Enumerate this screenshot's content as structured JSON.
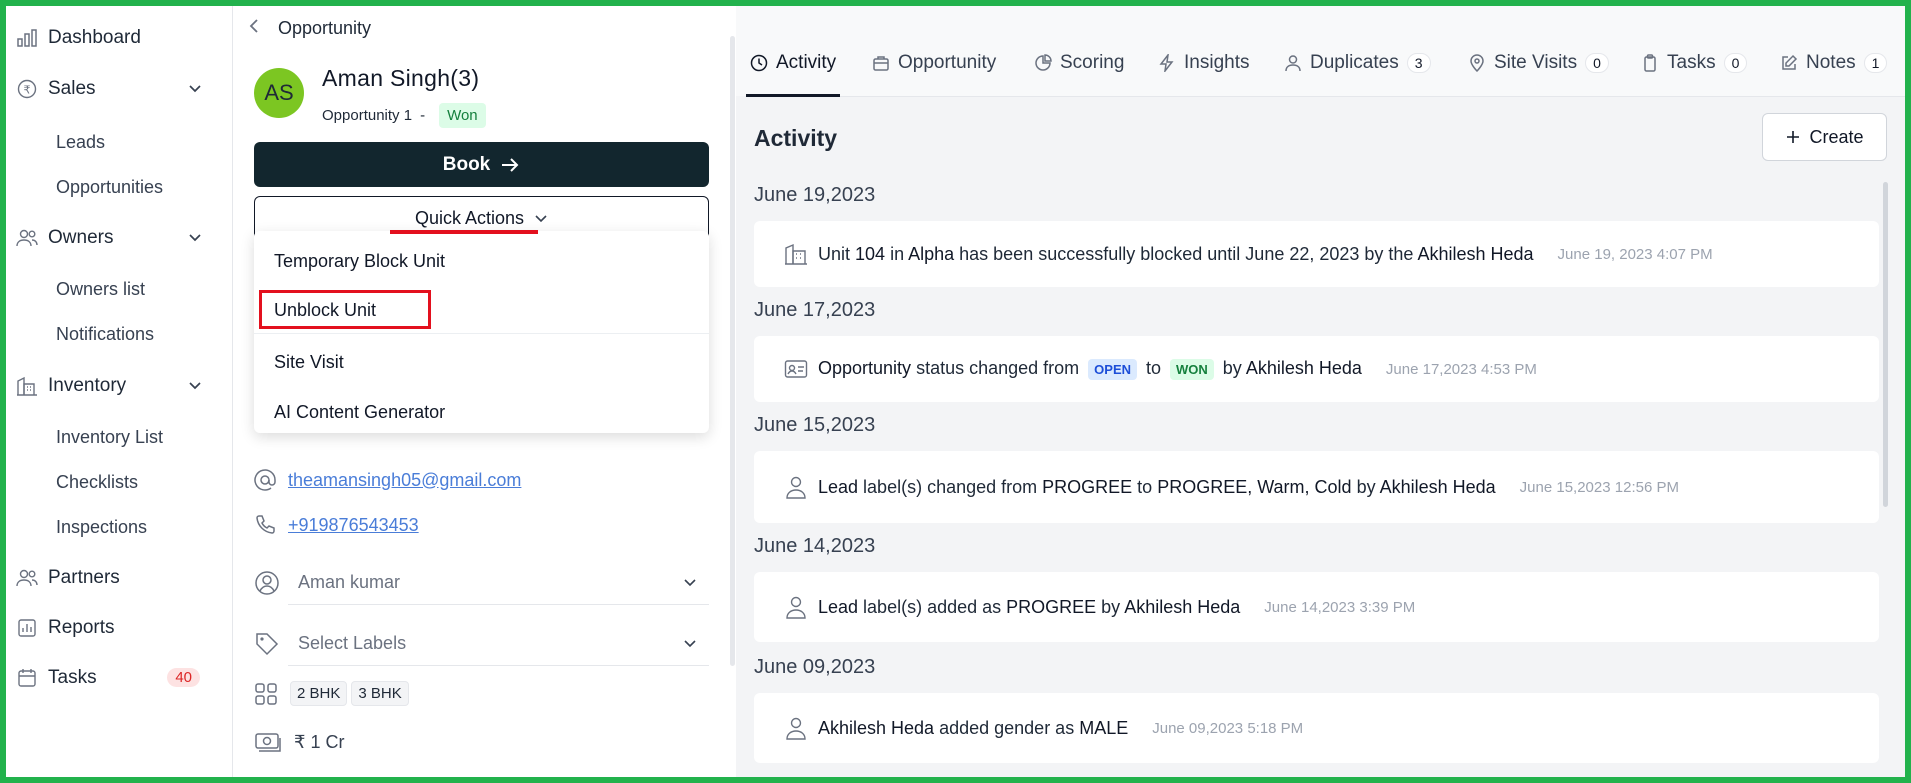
{
  "sidebar": {
    "items": [
      {
        "label": "Dashboard"
      },
      {
        "label": "Sales"
      },
      {
        "label": "Leads"
      },
      {
        "label": "Opportunities"
      },
      {
        "label": "Owners"
      },
      {
        "label": "Owners list"
      },
      {
        "label": "Notifications"
      },
      {
        "label": "Inventory"
      },
      {
        "label": "Inventory List"
      },
      {
        "label": "Checklists"
      },
      {
        "label": "Inspections"
      },
      {
        "label": "Partners"
      },
      {
        "label": "Reports"
      },
      {
        "label": "Tasks",
        "badge": "40"
      }
    ]
  },
  "detail": {
    "breadcrumb": "Opportunity",
    "avatar_initials": "AS",
    "name": "Aman  Singh(3)",
    "opportunity_label": "Opportunity 1",
    "separator": "-",
    "status": "Won",
    "book_label": "Book",
    "quick_actions_label": "Quick Actions",
    "quick_actions_menu": [
      "Temporary Block Unit",
      "Unblock Unit",
      "Site Visit",
      "AI Content Generator"
    ],
    "email": "theamansingh05@gmail.com",
    "phone": "+919876543453",
    "assignee": "Aman kumar",
    "labels_placeholder": "Select Labels",
    "configurations": [
      "2 BHK",
      "3 BHK"
    ],
    "budget": "₹ 1 Cr"
  },
  "tabs": [
    {
      "label": "Activity",
      "count": ""
    },
    {
      "label": "Opportunity",
      "count": ""
    },
    {
      "label": "Scoring",
      "count": ""
    },
    {
      "label": "Insights",
      "count": ""
    },
    {
      "label": "Duplicates",
      "count": "3"
    },
    {
      "label": "Site Visits",
      "count": "0"
    },
    {
      "label": "Tasks",
      "count": "0"
    },
    {
      "label": "Notes",
      "count": "1"
    }
  ],
  "activity": {
    "title": "Activity",
    "create_label": "Create",
    "groups": [
      {
        "date": "June 19,2023",
        "parts": [
          "Unit ",
          "104",
          " in ",
          "Alpha",
          " has been successfully blocked until June 22, 2023 by the ",
          "Akhilesh Heda"
        ],
        "stamp": "June 19, 2023 4:07 PM"
      },
      {
        "date": "June 17,2023",
        "parts": [
          "Opportunity",
          " status changed from ",
          "OPEN",
          " to ",
          "WON",
          " by ",
          "Akhilesh Heda"
        ],
        "stamp": "June 17,2023 4:53 PM"
      },
      {
        "date": "June 15,2023",
        "parts": [
          "Lead",
          " label(s) changed from ",
          "PROGREE",
          " to ",
          "PROGREE, Warm, Cold",
          " by ",
          "Akhilesh Heda"
        ],
        "stamp": "June 15,2023 12:56 PM"
      },
      {
        "date": "June 14,2023",
        "parts": [
          "Lead",
          " label(s) added as ",
          "PROGREE",
          " by ",
          "Akhilesh Heda"
        ],
        "stamp": "June 14,2023 3:39 PM"
      },
      {
        "date": "June 09,2023",
        "parts": [
          "Akhilesh Heda",
          " added gender as ",
          "MALE"
        ],
        "stamp": "June 09,2023 5:18 PM"
      }
    ]
  },
  "colors": {
    "frame": "#22b24c",
    "highlight": "#e3101e",
    "book_bg": "#12262e",
    "avatar": "#7cc622"
  }
}
